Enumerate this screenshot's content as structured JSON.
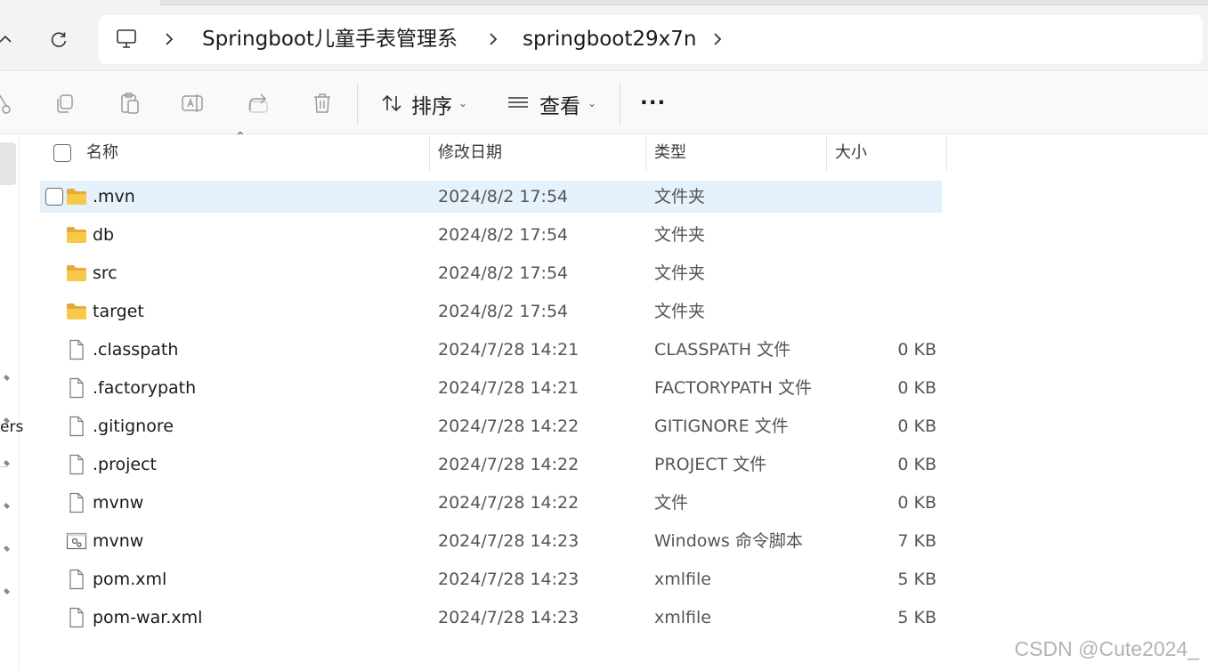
{
  "address_bar": {
    "crumbs": [
      "Springboot儿童手表管理系",
      "springboot29x7n"
    ]
  },
  "command_bar": {
    "sort_label": "排序",
    "view_label": "查看",
    "more_label": "···"
  },
  "left_pane": {
    "fragment_text": "ers"
  },
  "columns": {
    "name": "名称",
    "modified": "修改日期",
    "type": "类型",
    "size": "大小"
  },
  "files": [
    {
      "name": ".mvn",
      "modified": "2024/8/2 17:54",
      "type": "文件夹",
      "size": "",
      "icon": "folder-icon",
      "selected": true
    },
    {
      "name": "db",
      "modified": "2024/8/2 17:54",
      "type": "文件夹",
      "size": "",
      "icon": "folder-icon"
    },
    {
      "name": "src",
      "modified": "2024/8/2 17:54",
      "type": "文件夹",
      "size": "",
      "icon": "folder-icon"
    },
    {
      "name": "target",
      "modified": "2024/8/2 17:54",
      "type": "文件夹",
      "size": "",
      "icon": "folder-icon"
    },
    {
      "name": ".classpath",
      "modified": "2024/7/28 14:21",
      "type": "CLASSPATH 文件",
      "size": "0 KB",
      "icon": "file-icon"
    },
    {
      "name": ".factorypath",
      "modified": "2024/7/28 14:21",
      "type": "FACTORYPATH 文件",
      "size": "0 KB",
      "icon": "file-icon"
    },
    {
      "name": ".gitignore",
      "modified": "2024/7/28 14:22",
      "type": "GITIGNORE 文件",
      "size": "0 KB",
      "icon": "file-icon"
    },
    {
      "name": ".project",
      "modified": "2024/7/28 14:22",
      "type": "PROJECT 文件",
      "size": "0 KB",
      "icon": "file-icon"
    },
    {
      "name": "mvnw",
      "modified": "2024/7/28 14:22",
      "type": "文件",
      "size": "0 KB",
      "icon": "file-icon"
    },
    {
      "name": "mvnw",
      "modified": "2024/7/28 14:23",
      "type": "Windows 命令脚本",
      "size": "7 KB",
      "icon": "script-icon"
    },
    {
      "name": "pom.xml",
      "modified": "2024/7/28 14:23",
      "type": "xmlfile",
      "size": "5 KB",
      "icon": "file-icon"
    },
    {
      "name": "pom-war.xml",
      "modified": "2024/7/28 14:23",
      "type": "xmlfile",
      "size": "5 KB",
      "icon": "file-icon"
    }
  ],
  "watermark": "CSDN @Cute2024_",
  "colors": {
    "selection": "#e5f1fb",
    "folder": "#f6c445",
    "accent": "#0067c0"
  }
}
